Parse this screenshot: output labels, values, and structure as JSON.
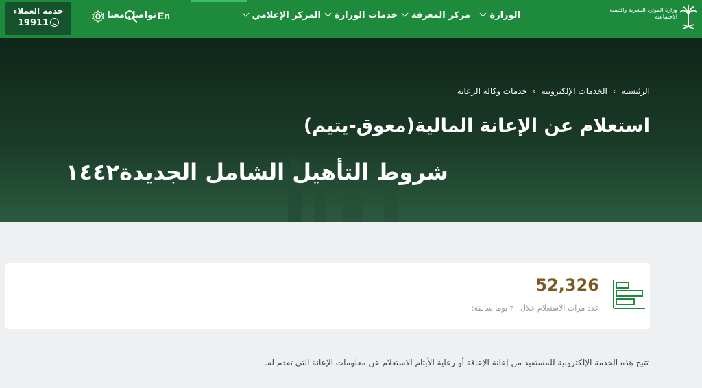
{
  "header": {
    "customer_service": {
      "title": "خدمة العملاء",
      "number": "19911"
    },
    "lang_switch": "En",
    "menu": [
      "الوزارة",
      "مركز المعرفة",
      "خدمات الوزارة",
      "المركز الإعلامي",
      "تواصل معنا"
    ],
    "logo_text": "وزارة الموارد البشرية والتنمية الاجتماعية",
    "colors": {
      "nav_bg": "#1e8a3c",
      "service_box": "#14532c"
    }
  },
  "breadcrumb": [
    "الرئيسية",
    "الخدمات الإلكترونية",
    "خدمات وكالة الرعاية"
  ],
  "page_title": "استعلام عن الإعانة المالية(معوق-يتيم)",
  "overlay_title": "شروط التأهيل الشامل الجديدة١٤٤٢",
  "stats": {
    "count": "52,326",
    "label": "عدد مرات الاستعلام خلال ٣٠ يوما سابقة:"
  },
  "description": "تتيح هذه الخدمة الإلكترونية للمستفيد من إعانة الإعاقة أو رعاية الأيتام الاستعلام عن معلومات الإعانة التي تقدم له."
}
